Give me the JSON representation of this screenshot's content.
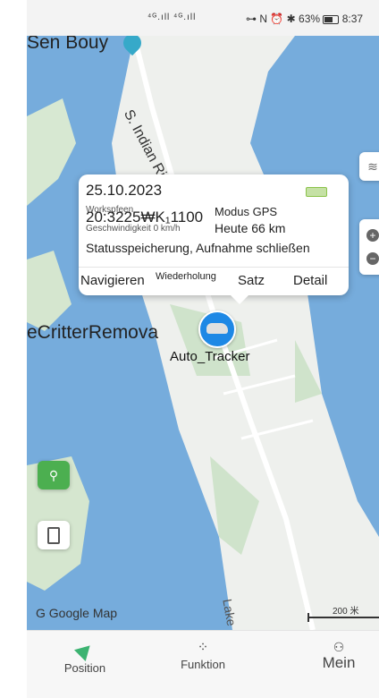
{
  "status_bar": {
    "signal": "⁴ᴳ.ıll ⁴ᴳ.ıll",
    "indicators": "⊶ N ⏰ ✱",
    "battery_percent": "63%",
    "time": "8:37"
  },
  "map": {
    "labels": {
      "poi_top": "Sen Bouy",
      "river": "S. Indian River",
      "poi_left": "eCritterRemova",
      "lake": "Lake",
      "google": "G Google Map",
      "scale": "200 米"
    },
    "colors": {
      "water": "#76acdc",
      "land": "#eef0ed",
      "green": "#c8e6c9",
      "accent": "#4caf50"
    }
  },
  "popup": {
    "date": "25.10.2023",
    "time_overlay": "20:3225₩K₁1100",
    "small_line_1": "Workspfeen",
    "mode": "Modus GPS",
    "speed": "Geschwindigkeit 0 km/h",
    "today": "Heute 66 km",
    "status": "Statusspeicherung, Aufnahme schließen",
    "actions": {
      "navigate": "Navigieren",
      "replay": "Wiederholung",
      "satz": "Satz",
      "detail": "Detail"
    }
  },
  "vehicle": {
    "label": "Auto_Tracker"
  },
  "tabs": [
    {
      "label": "Position",
      "icon": "navigation-arrow-icon"
    },
    {
      "label": "Funktion",
      "icon": "grid-icon"
    },
    {
      "label": "Mein",
      "icon": "person-icon"
    }
  ]
}
